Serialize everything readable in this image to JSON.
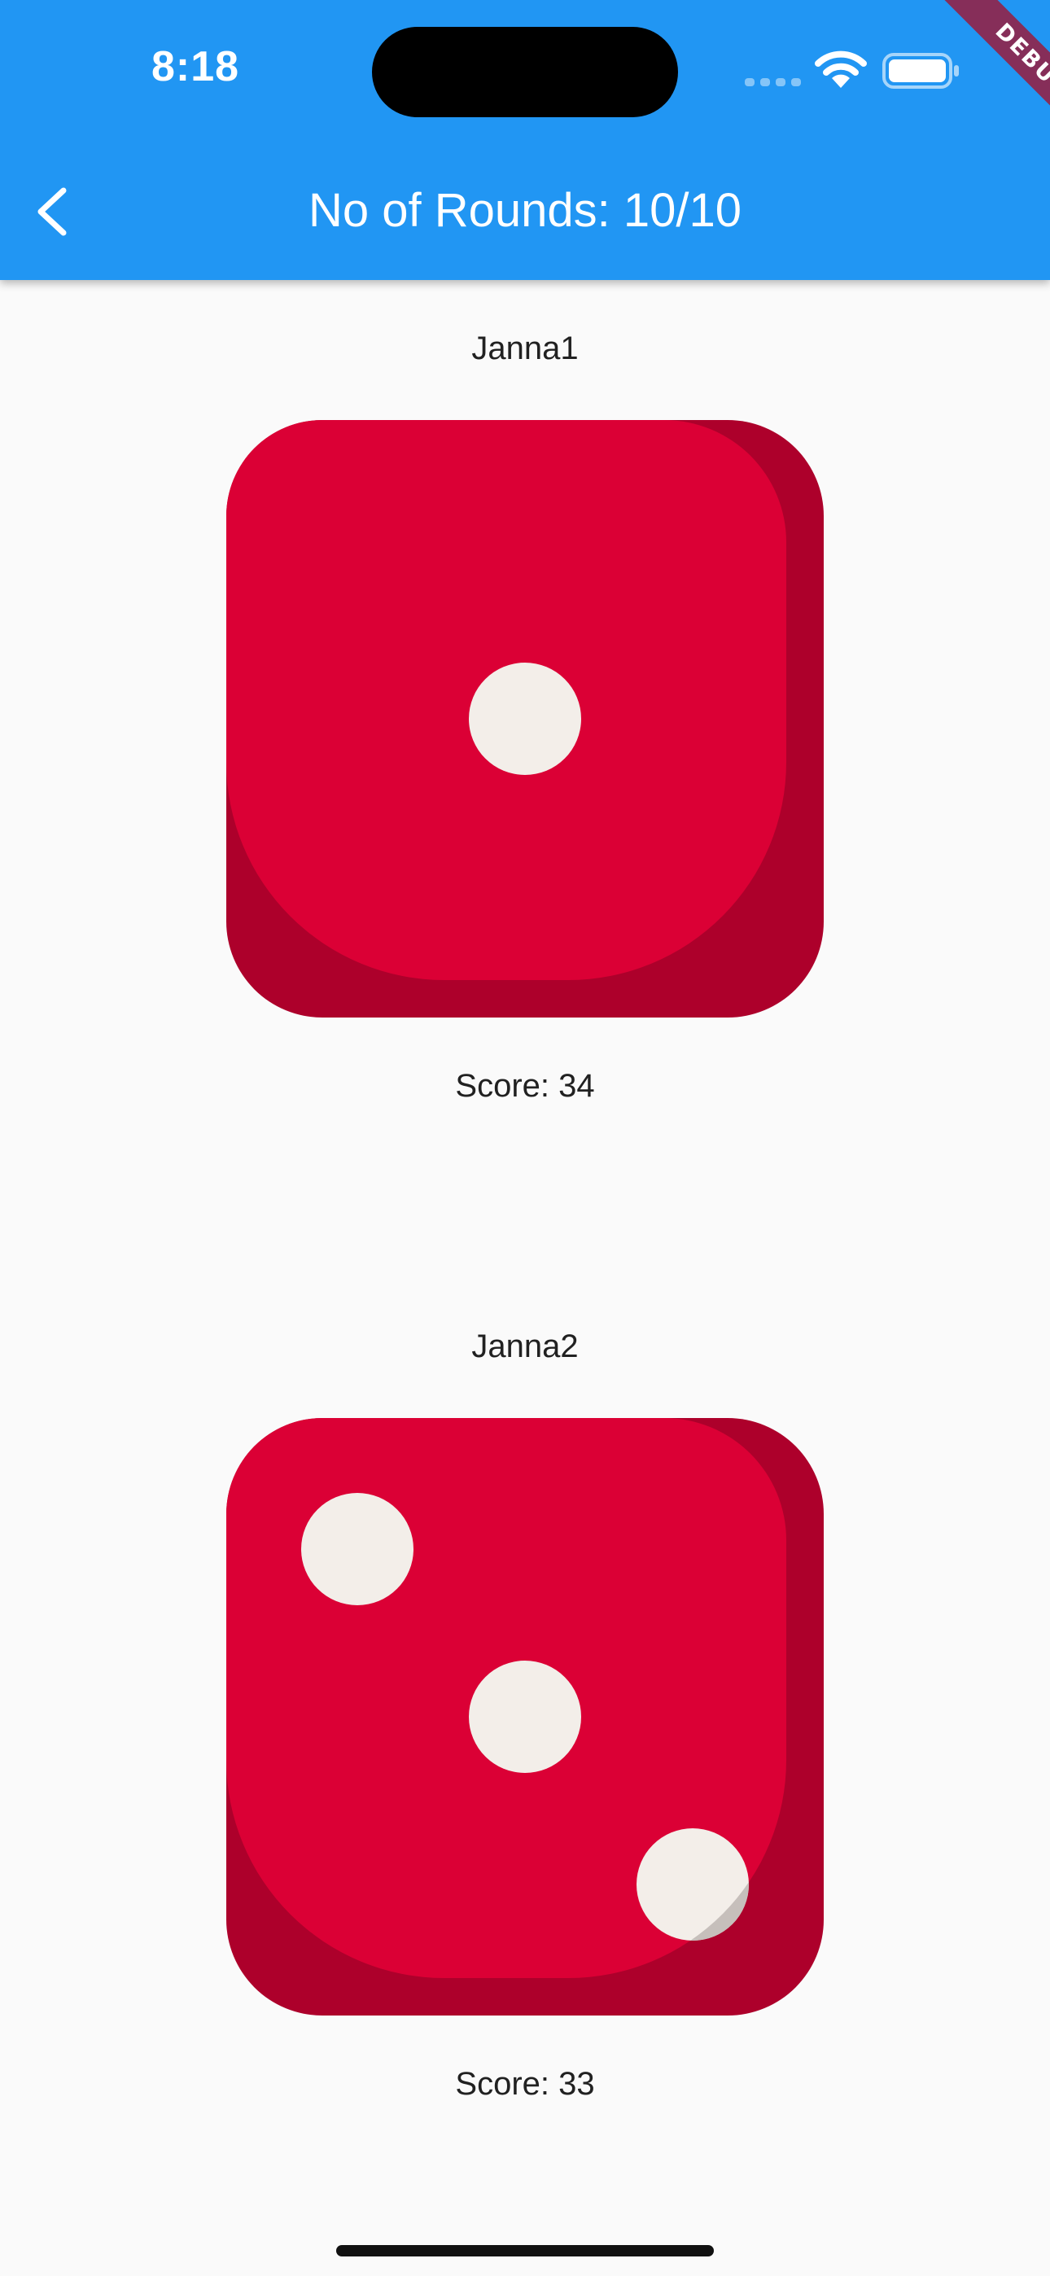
{
  "status_bar": {
    "time": "8:18"
  },
  "app_bar": {
    "title": "No of Rounds: 10/10",
    "back_icon": "chevron-left-icon",
    "color": "#2196f3"
  },
  "debug_banner": {
    "label": "DEBUG"
  },
  "players": [
    {
      "name": "Janna1",
      "die_value": 1,
      "score_text": "Score: 34"
    },
    {
      "name": "Janna2",
      "die_value": 3,
      "score_text": "Score: 33"
    }
  ],
  "colors": {
    "die_face": "#db0035",
    "die_shade": "#ad002b",
    "pip": "#f3eee9",
    "background": "#fafafa"
  }
}
